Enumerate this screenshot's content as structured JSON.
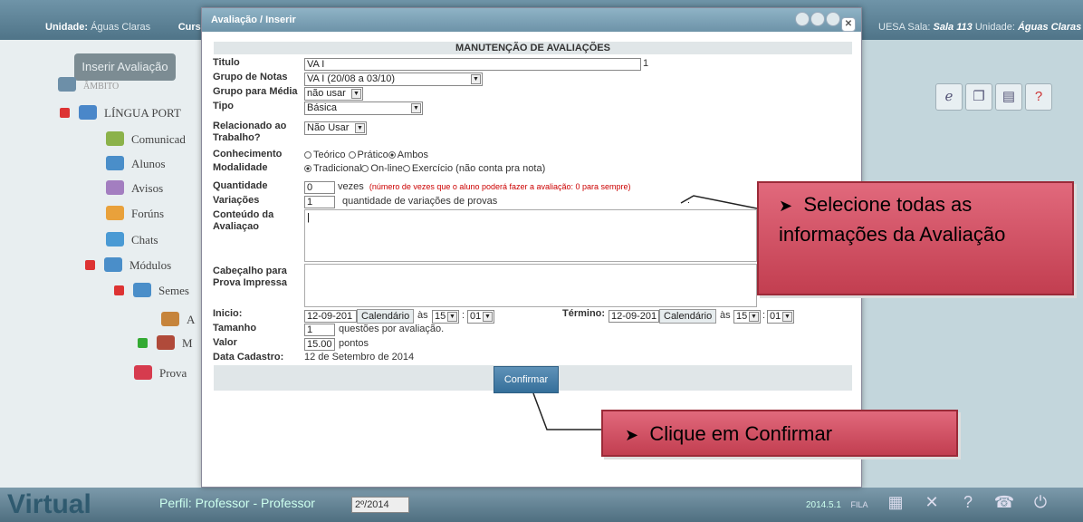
{
  "topbar": {
    "left_label": "Unidade:",
    "left_value": "Águas Claras",
    "curso_label": "Curso:",
    "right_text": "UESA Sala:",
    "sala": "Sala 113",
    "unidade_label": "Unidade:",
    "unidade_val": "Águas Claras"
  },
  "left": {
    "inserir": "Inserir Avaliação",
    "cut_item": "ÂMBITO",
    "items": [
      "LÍNGUA PORT",
      "Comunicad",
      "Alunos",
      "Avisos",
      "Forúns",
      "Chats",
      "Módulos",
      "Semes",
      "A",
      "M",
      "Prova"
    ]
  },
  "dialog": {
    "title": "Avaliação / Inserir",
    "header": "MANUTENÇÃO DE AVALIAÇÕES",
    "labels": {
      "titulo": "Titulo",
      "grupo_notas": "Grupo de Notas",
      "grupo_media": "Grupo para Média",
      "tipo": "Tipo",
      "relacionado": "Relacionado ao",
      "trabalho": "Trabalho?",
      "conhecimento": "Conhecimento",
      "modalidade": "Modalidade",
      "quantidade": "Quantidade",
      "variacoes": "Variações",
      "conteudo": "Conteúdo da",
      "avaliacao": "Avaliaçao",
      "cabecalho": "Cabeçalho para",
      "prova": "Prova Impressa",
      "inicio": "Inicio:",
      "termino": "Término:",
      "tamanho": "Tamanho",
      "valor": "Valor",
      "data_cad": "Data Cadastro:"
    },
    "values": {
      "titulo": "VA I",
      "titulo_count": "1",
      "grupo_notas": "VA I (20/08 a 03/10)",
      "grupo_media": "não usar",
      "tipo": "Básica",
      "relacionado": "Não Usar",
      "conh_teorico": "Teórico",
      "conh_pratico": "Prático",
      "conh_ambos": "Ambos",
      "mod_trad": "Tradicional",
      "mod_online": "On-line",
      "mod_exerc": "Exercício (não conta pra nota)",
      "quantidade": "0",
      "vezes": "vezes",
      "vezes_note": "(número de vezes que o aluno poderá fazer a avaliação: 0 para sempre)",
      "variacoes": "1",
      "variacoes_text": "quantidade de variações de provas",
      "conteudo": "|",
      "inicio_date": "12-09-201",
      "calendario": "Calendário",
      "as": "às",
      "hora": "15",
      "min": "01",
      "termino_date": "12-09-201",
      "tamanho": "1",
      "tamanho_text": "questões por avaliação.",
      "valor": "15.00",
      "pontos": "pontos",
      "data_cad": "12 de Setembro de 2014"
    },
    "confirm": "Confirmar"
  },
  "callouts": {
    "one": "Selecione todas as informações da Avaliação",
    "two": "Clique em Confirmar"
  },
  "bottombar": {
    "logo": "Virtual",
    "perfil": "Perfil: Professor - Professor",
    "semestre": "2º/2014",
    "version": "2014.5.1",
    "fila": "FILA"
  }
}
